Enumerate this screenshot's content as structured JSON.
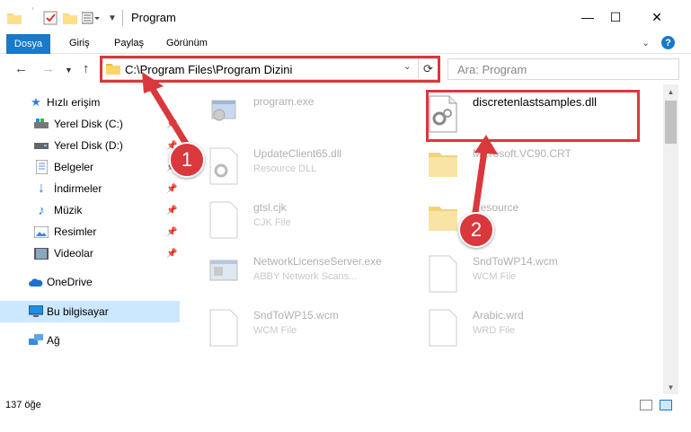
{
  "window": {
    "title": "Program",
    "minimize": "—",
    "maximize": "☐",
    "close": "✕"
  },
  "ribbon": {
    "tabs": [
      "Dosya",
      "Giriş",
      "Paylaş",
      "Görünüm"
    ],
    "help": "?"
  },
  "nav": {
    "address": "C:\\Program Files\\Program Dizini",
    "search_placeholder": "Ara: Program"
  },
  "sidebar": {
    "items": [
      {
        "label": "Hızlı erişim",
        "icon": "star-icon",
        "pinned": false
      },
      {
        "label": "Yerel Disk (C:)",
        "icon": "drive-icon",
        "pinned": true
      },
      {
        "label": "Yerel Disk (D:)",
        "icon": "drive-icon",
        "pinned": true
      },
      {
        "label": "Belgeler",
        "icon": "documents-icon",
        "pinned": true
      },
      {
        "label": "İndirmeler",
        "icon": "download-icon",
        "pinned": true
      },
      {
        "label": "Müzik",
        "icon": "music-icon",
        "pinned": true
      },
      {
        "label": "Resimler",
        "icon": "pictures-icon",
        "pinned": true
      },
      {
        "label": "Videolar",
        "icon": "videos-icon",
        "pinned": true
      },
      {
        "label": "OneDrive",
        "icon": "cloud-icon",
        "pinned": false
      },
      {
        "label": "Bu bilgisayar",
        "icon": "computer-icon",
        "pinned": false
      },
      {
        "label": "Ağ",
        "icon": "network-icon",
        "pinned": false
      }
    ]
  },
  "files": [
    {
      "name": "program.exe",
      "type": ""
    },
    {
      "name": "discretenlastsamples.dll",
      "type": ""
    },
    {
      "name": "UpdateClient65.dll",
      "type": "Resource DLL"
    },
    {
      "name": "Microsoft.VC90.CRT",
      "type": ""
    },
    {
      "name": "gtsl.cjk",
      "type": "CJK File"
    },
    {
      "name": "Resource",
      "type": ""
    },
    {
      "name": "NetworkLicenseServer.exe",
      "type": "ABBY Network Scans..."
    },
    {
      "name": "SndToWP14.wcm",
      "type": "WCM File"
    },
    {
      "name": "SndToWP15.wcm",
      "type": "WCM File"
    },
    {
      "name": "Arabic.wrd",
      "type": "WRD File"
    }
  ],
  "annotations": {
    "badge1": "1",
    "badge2": "2"
  },
  "status": {
    "count": "137 öğe"
  },
  "colors": {
    "accent": "#1979ca",
    "highlight_red": "#d9383c",
    "selection": "#cce8ff"
  }
}
